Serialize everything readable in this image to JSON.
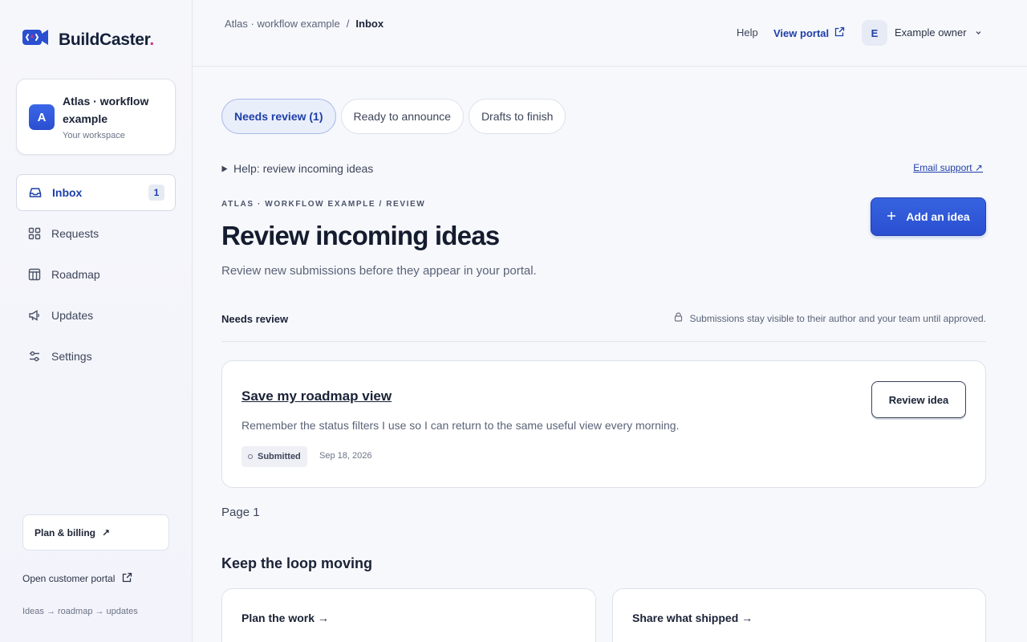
{
  "brand": {
    "name": "BuildCaster",
    "dot": "."
  },
  "workspace": {
    "initial": "A",
    "name": "Atlas · workflow example",
    "subtitle": "Your workspace"
  },
  "nav": {
    "items": [
      {
        "label": "Inbox",
        "badge": "1",
        "icon": "inbox-icon",
        "active": true
      },
      {
        "label": "Requests",
        "icon": "grid-icon"
      },
      {
        "label": "Roadmap",
        "icon": "columns-icon"
      },
      {
        "label": "Updates",
        "icon": "megaphone-icon"
      },
      {
        "label": "Settings",
        "icon": "sliders-icon"
      }
    ]
  },
  "sidebar_footer": {
    "plan_label": "Plan & billing",
    "plan_arrow": "↗",
    "portal_label": "Open customer portal",
    "loop_text": "Ideas → roadmap → updates"
  },
  "topbar": {
    "breadcrumb": {
      "workspace": "Atlas · workflow example",
      "separator": "/",
      "current": "Inbox"
    },
    "help": "Help",
    "view_portal": "View portal",
    "owner_initial": "E",
    "owner_name": "Example owner"
  },
  "tabs": [
    {
      "label": "Needs review (1)",
      "active": true
    },
    {
      "label": "Ready to announce"
    },
    {
      "label": "Drafts to finish"
    }
  ],
  "help_toggle": "Help: review incoming ideas",
  "email_support": "Email support ↗",
  "eyebrow": "ATLAS · WORKFLOW EXAMPLE / REVIEW",
  "title": "Review incoming ideas",
  "subtitle": "Review new submissions before they appear in your portal.",
  "add_button": "Add an idea",
  "section": {
    "heading": "Needs review",
    "note": "Submissions stay visible to their author and your team until approved."
  },
  "idea": {
    "title": "Save my roadmap view",
    "description": "Remember the status filters I use so I can return to the same useful view every morning.",
    "status": "Submitted",
    "date": "Sep 18, 2026",
    "action": "Review idea"
  },
  "pagination": "Page 1",
  "loop": {
    "heading": "Keep the loop moving",
    "cards": [
      {
        "title": "Plan the work →"
      },
      {
        "title": "Share what shipped →"
      }
    ]
  },
  "colors": {
    "accent": "#2a4fd0",
    "brand_dot": "#d6338a",
    "background": "#f7f8fc"
  }
}
